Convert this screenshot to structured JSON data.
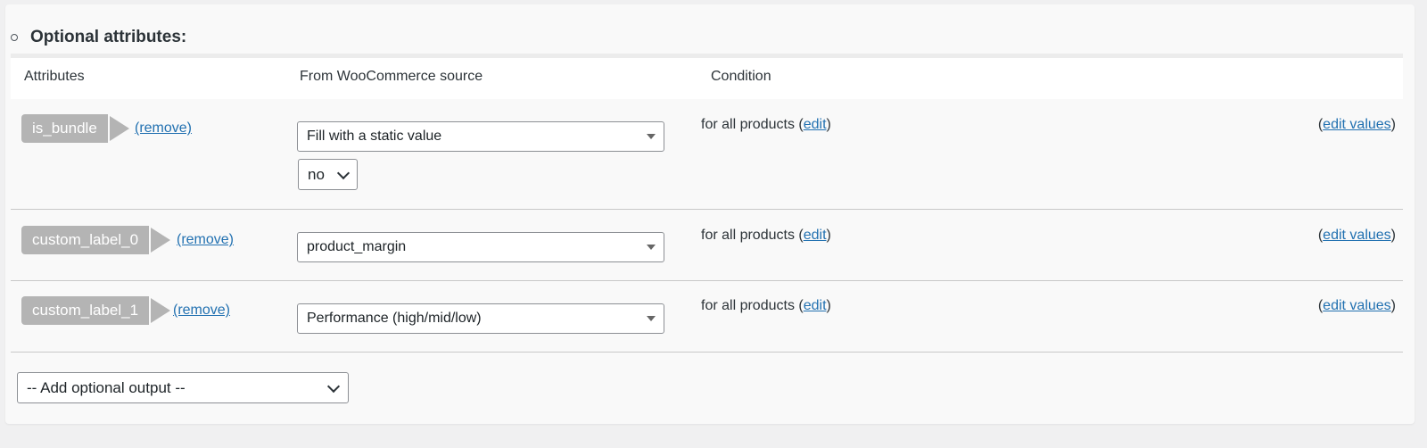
{
  "section": {
    "title": "Optional attributes:"
  },
  "table": {
    "headers": [
      "Attributes",
      "From WooCommerce source",
      "Condition"
    ],
    "rows": [
      {
        "attribute": "is_bundle",
        "remove_label": "(remove)",
        "source": "Fill with a static value",
        "static_value": "no",
        "condition_text": "for all products (",
        "edit_label": "edit",
        "condition_close": ")",
        "edit_values_open": "(",
        "edit_values_label": "edit values",
        "edit_values_close": ")"
      },
      {
        "attribute": "custom_label_0",
        "remove_label": "(remove)",
        "source": "product_margin",
        "condition_text": "for all products (",
        "edit_label": "edit",
        "condition_close": ")",
        "edit_values_open": "(",
        "edit_values_label": "edit values",
        "edit_values_close": ")"
      },
      {
        "attribute": "custom_label_1",
        "remove_label": "(remove)",
        "source": "Performance (high/mid/low)",
        "condition_text": "for all products (",
        "edit_label": "edit",
        "condition_close": ")",
        "edit_values_open": "(",
        "edit_values_label": "edit values",
        "edit_values_close": ")"
      }
    ]
  },
  "add_output": {
    "selected": "-- Add optional output --"
  },
  "colors": {
    "link": "#2271b1",
    "tag": "#b4b4b4",
    "panel": "#f9f9f9",
    "page_bg": "#f0f0f1"
  }
}
